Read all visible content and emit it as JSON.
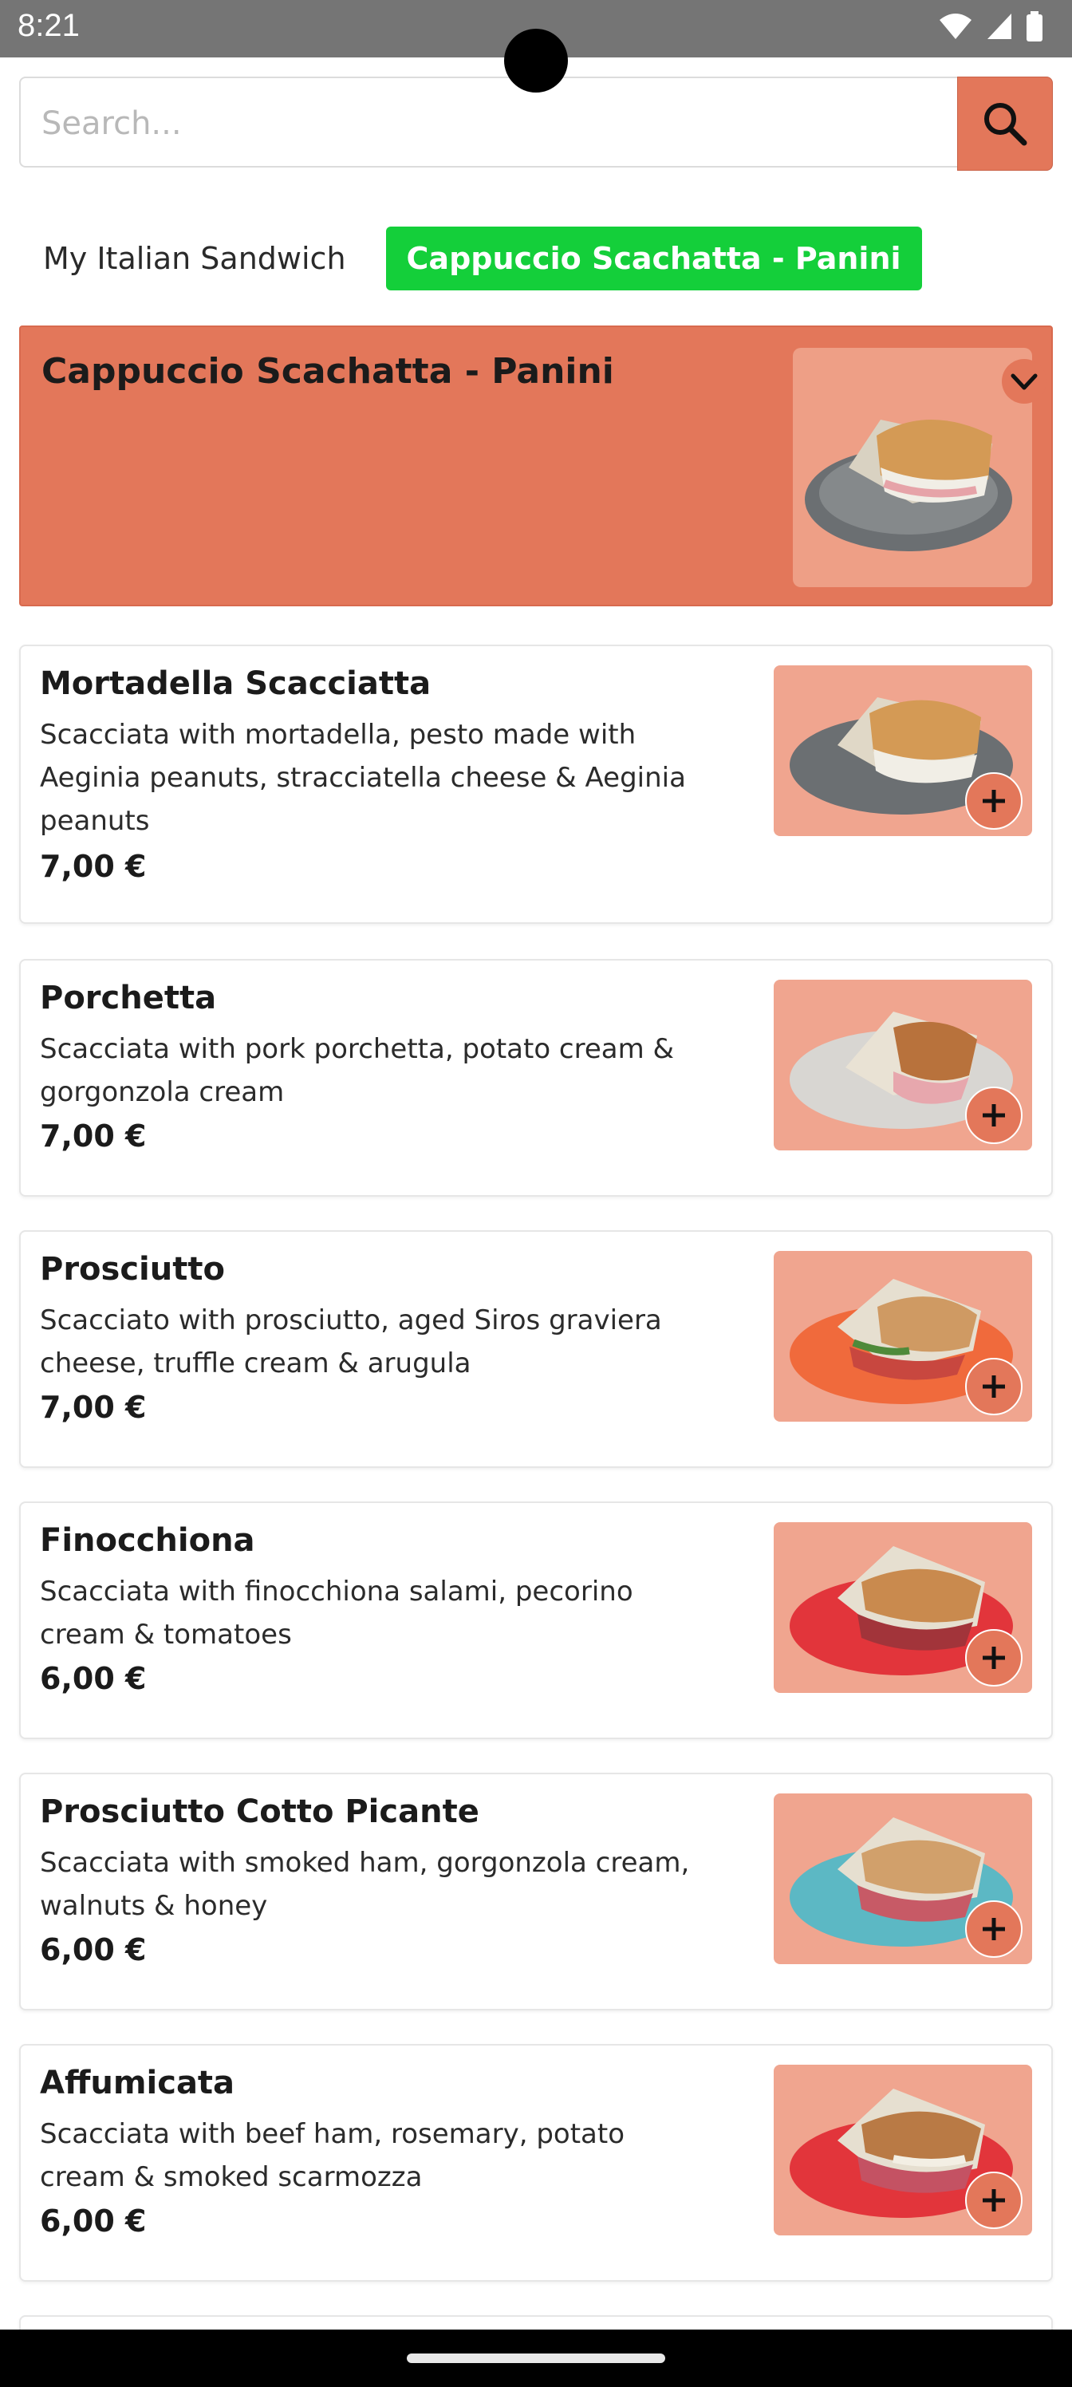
{
  "status_bar": {
    "time": "8:21"
  },
  "search": {
    "placeholder": "Search...",
    "icon": "search-icon"
  },
  "tabs": [
    {
      "label": "My Italian Sandwich",
      "active": false
    },
    {
      "label": "Cappuccio Scachatta - Panini",
      "active": true
    }
  ],
  "category": {
    "title": "Cappuccio Scachatta - Panini",
    "icon": "chevron-down-icon"
  },
  "items": [
    {
      "name": "Mortadella Scacciatta",
      "description": "Scacciata with mortadella, pesto made with Aeginia peanuts, stracciatella cheese & Aeginia peanuts",
      "price": "7,00 €"
    },
    {
      "name": "Porchetta",
      "description": "Scacciata with pork porchetta, potato cream & gorgonzola cream",
      "price": "7,00 €"
    },
    {
      "name": "Prosciutto",
      "description": "Scacciato with prosciutto, aged Siros graviera cheese, truffle cream & arugula",
      "price": "7,00 €"
    },
    {
      "name": "Finocchiona",
      "description": "Scacciata with finocchiona salami, pecorino cream & tomatoes",
      "price": "6,00 €"
    },
    {
      "name": "Prosciutto Cotto Picante",
      "description": "Scacciata with smoked ham, gorgonzola cream, walnuts & honey",
      "price": "6,00 €"
    },
    {
      "name": "Affumicata",
      "description": "Scacciata with beef ham, rosemary, potato cream & smoked scarmozza",
      "price": "6,00 €"
    }
  ],
  "colors": {
    "accent": "#e3775a",
    "active_tab": "#14cf3a",
    "image_bg": "#f0a58f"
  }
}
